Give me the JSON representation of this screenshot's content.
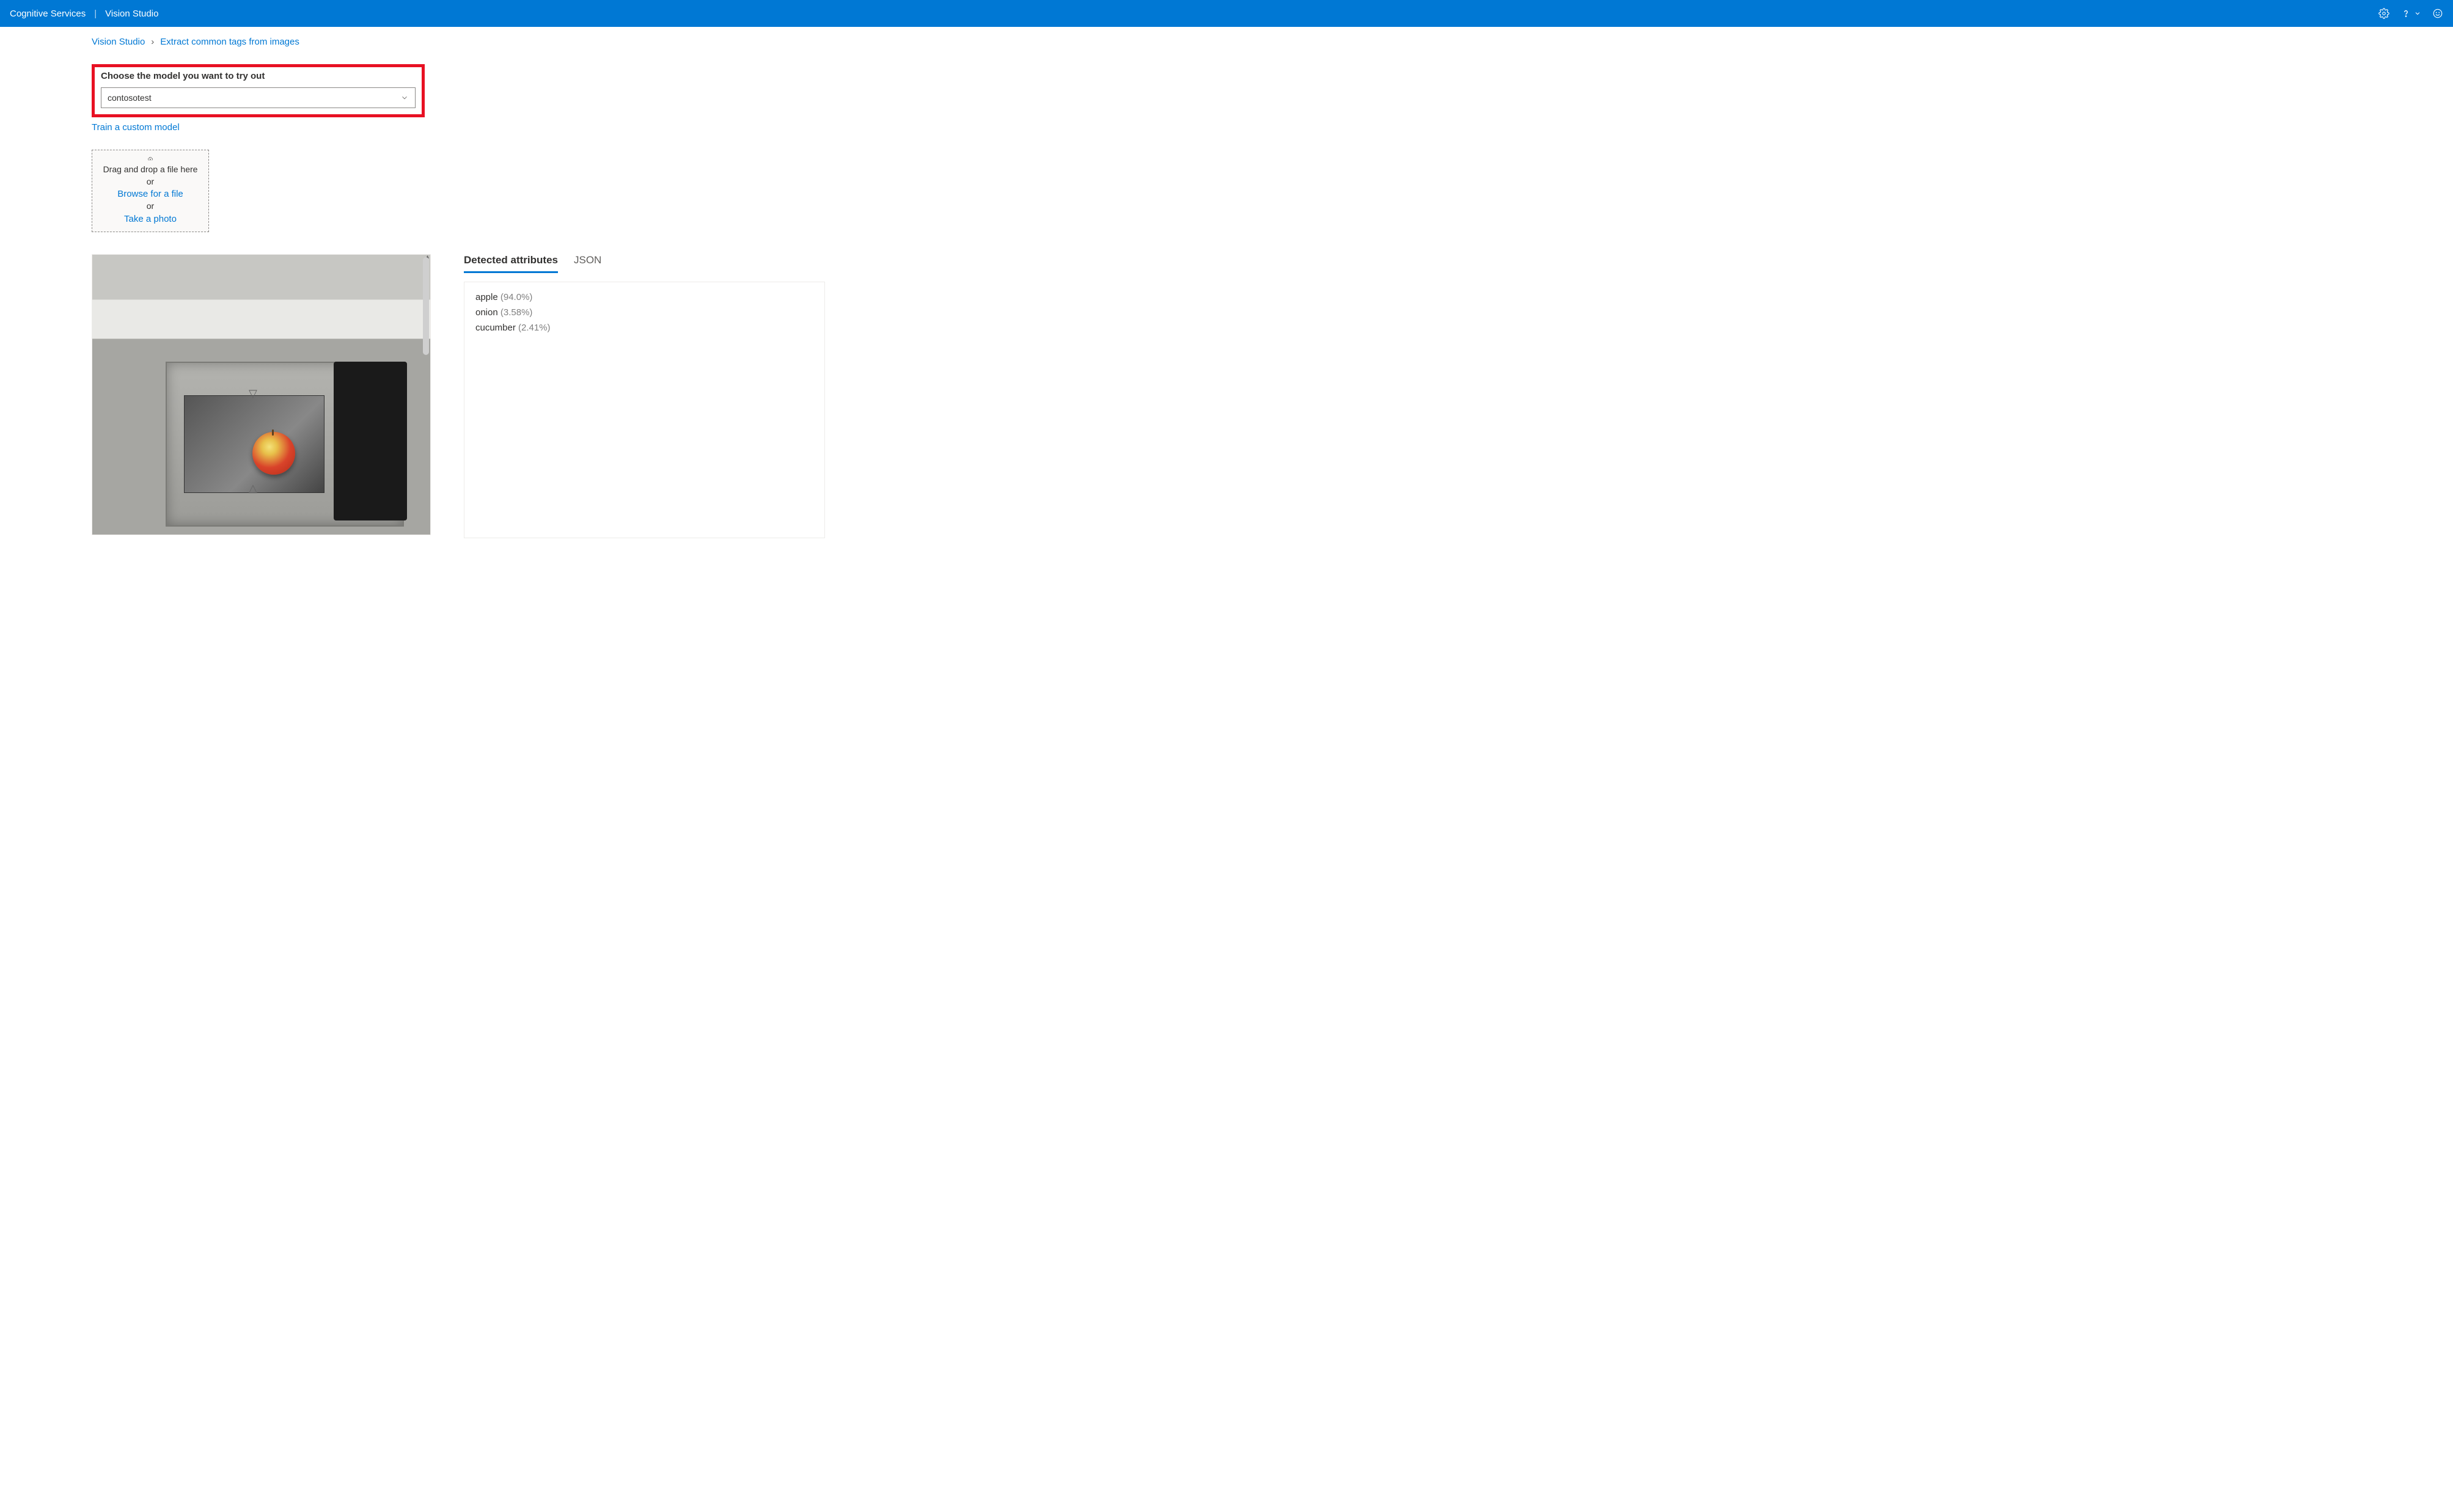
{
  "header": {
    "brand": "Cognitive Services",
    "separator": "|",
    "product": "Vision Studio"
  },
  "breadcrumb": {
    "root": "Vision Studio",
    "page": "Extract common tags from images"
  },
  "model_selector": {
    "label": "Choose the model you want to try out",
    "selected": "contosotest"
  },
  "train_link": "Train a custom model",
  "upload": {
    "drag_text": "Drag and drop a file here",
    "or1": "or",
    "browse_link": "Browse for a file",
    "or2": "or",
    "photo_link": "Take a photo"
  },
  "tabs": {
    "detected": "Detected attributes",
    "json": "JSON"
  },
  "results": [
    {
      "name": "apple",
      "prob": "(94.0%)"
    },
    {
      "name": "onion",
      "prob": "(3.58%)"
    },
    {
      "name": "cucumber",
      "prob": "(2.41%)"
    }
  ]
}
